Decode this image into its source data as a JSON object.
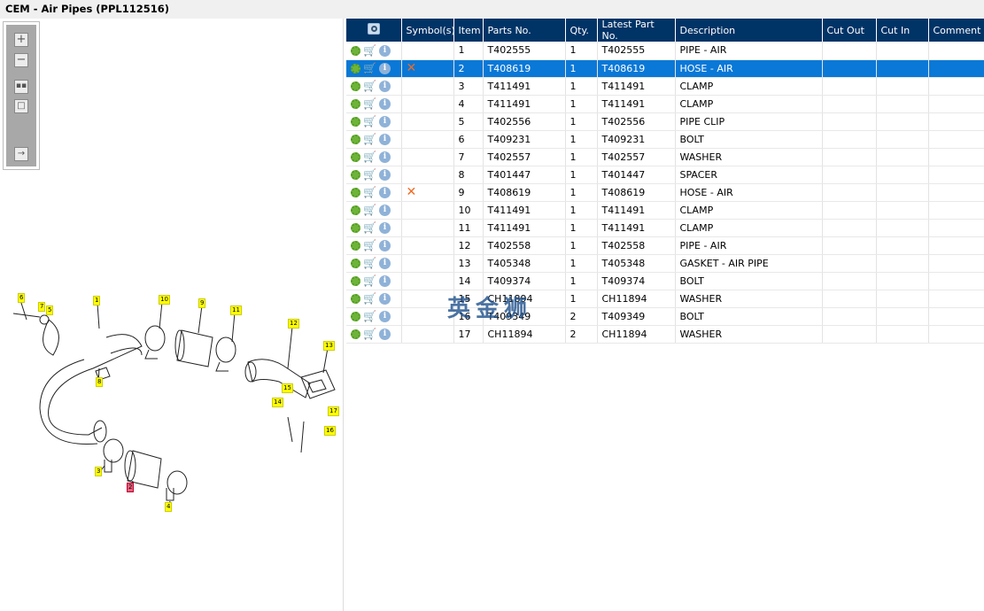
{
  "title": "CEM - Air Pipes (PPL112516)",
  "toolbar": {
    "items": [
      "zoom-in",
      "zoom-out",
      "fit-all",
      "actual-size",
      "export-list"
    ]
  },
  "table": {
    "columns": [
      "",
      "Symbol(s)",
      "Item",
      "Parts No.",
      "Qty.",
      "Latest Part No.",
      "Description",
      "Cut Out",
      "Cut In",
      "Comment"
    ],
    "selected_row": 1,
    "rows": [
      {
        "symbol": "",
        "item": "1",
        "part": "T402555",
        "qty": "1",
        "latest": "T402555",
        "desc": "PIPE - AIR"
      },
      {
        "symbol": "✕",
        "item": "2",
        "part": "T408619",
        "qty": "1",
        "latest": "T408619",
        "desc": "HOSE - AIR"
      },
      {
        "symbol": "",
        "item": "3",
        "part": "T411491",
        "qty": "1",
        "latest": "T411491",
        "desc": "CLAMP"
      },
      {
        "symbol": "",
        "item": "4",
        "part": "T411491",
        "qty": "1",
        "latest": "T411491",
        "desc": "CLAMP"
      },
      {
        "symbol": "",
        "item": "5",
        "part": "T402556",
        "qty": "1",
        "latest": "T402556",
        "desc": "PIPE CLIP"
      },
      {
        "symbol": "",
        "item": "6",
        "part": "T409231",
        "qty": "1",
        "latest": "T409231",
        "desc": "BOLT"
      },
      {
        "symbol": "",
        "item": "7",
        "part": "T402557",
        "qty": "1",
        "latest": "T402557",
        "desc": "WASHER"
      },
      {
        "symbol": "",
        "item": "8",
        "part": "T401447",
        "qty": "1",
        "latest": "T401447",
        "desc": "SPACER"
      },
      {
        "symbol": "✕",
        "item": "9",
        "part": "T408619",
        "qty": "1",
        "latest": "T408619",
        "desc": "HOSE - AIR"
      },
      {
        "symbol": "",
        "item": "10",
        "part": "T411491",
        "qty": "1",
        "latest": "T411491",
        "desc": "CLAMP"
      },
      {
        "symbol": "",
        "item": "11",
        "part": "T411491",
        "qty": "1",
        "latest": "T411491",
        "desc": "CLAMP"
      },
      {
        "symbol": "",
        "item": "12",
        "part": "T402558",
        "qty": "1",
        "latest": "T402558",
        "desc": "PIPE - AIR"
      },
      {
        "symbol": "",
        "item": "13",
        "part": "T405348",
        "qty": "1",
        "latest": "T405348",
        "desc": "GASKET - AIR PIPE"
      },
      {
        "symbol": "",
        "item": "14",
        "part": "T409374",
        "qty": "1",
        "latest": "T409374",
        "desc": "BOLT"
      },
      {
        "symbol": "",
        "item": "15",
        "part": "CH11894",
        "qty": "1",
        "latest": "CH11894",
        "desc": "WASHER"
      },
      {
        "symbol": "",
        "item": "16",
        "part": "T409349",
        "qty": "2",
        "latest": "T409349",
        "desc": "BOLT"
      },
      {
        "symbol": "",
        "item": "17",
        "part": "CH11894",
        "qty": "2",
        "latest": "CH11894",
        "desc": "WASHER"
      }
    ]
  },
  "watermark": "英金狮",
  "diagram": {
    "callouts": [
      "6",
      "7",
      "5",
      "1",
      "10",
      "9",
      "11",
      "12",
      "13",
      "15",
      "14",
      "17",
      "16",
      "8",
      "3",
      "2",
      "4"
    ],
    "highlighted": "2",
    "highlight_color": "#e8607a"
  },
  "colors": {
    "header": "#003366",
    "selected": "#0a78d7",
    "symbol": "#f06a22"
  }
}
